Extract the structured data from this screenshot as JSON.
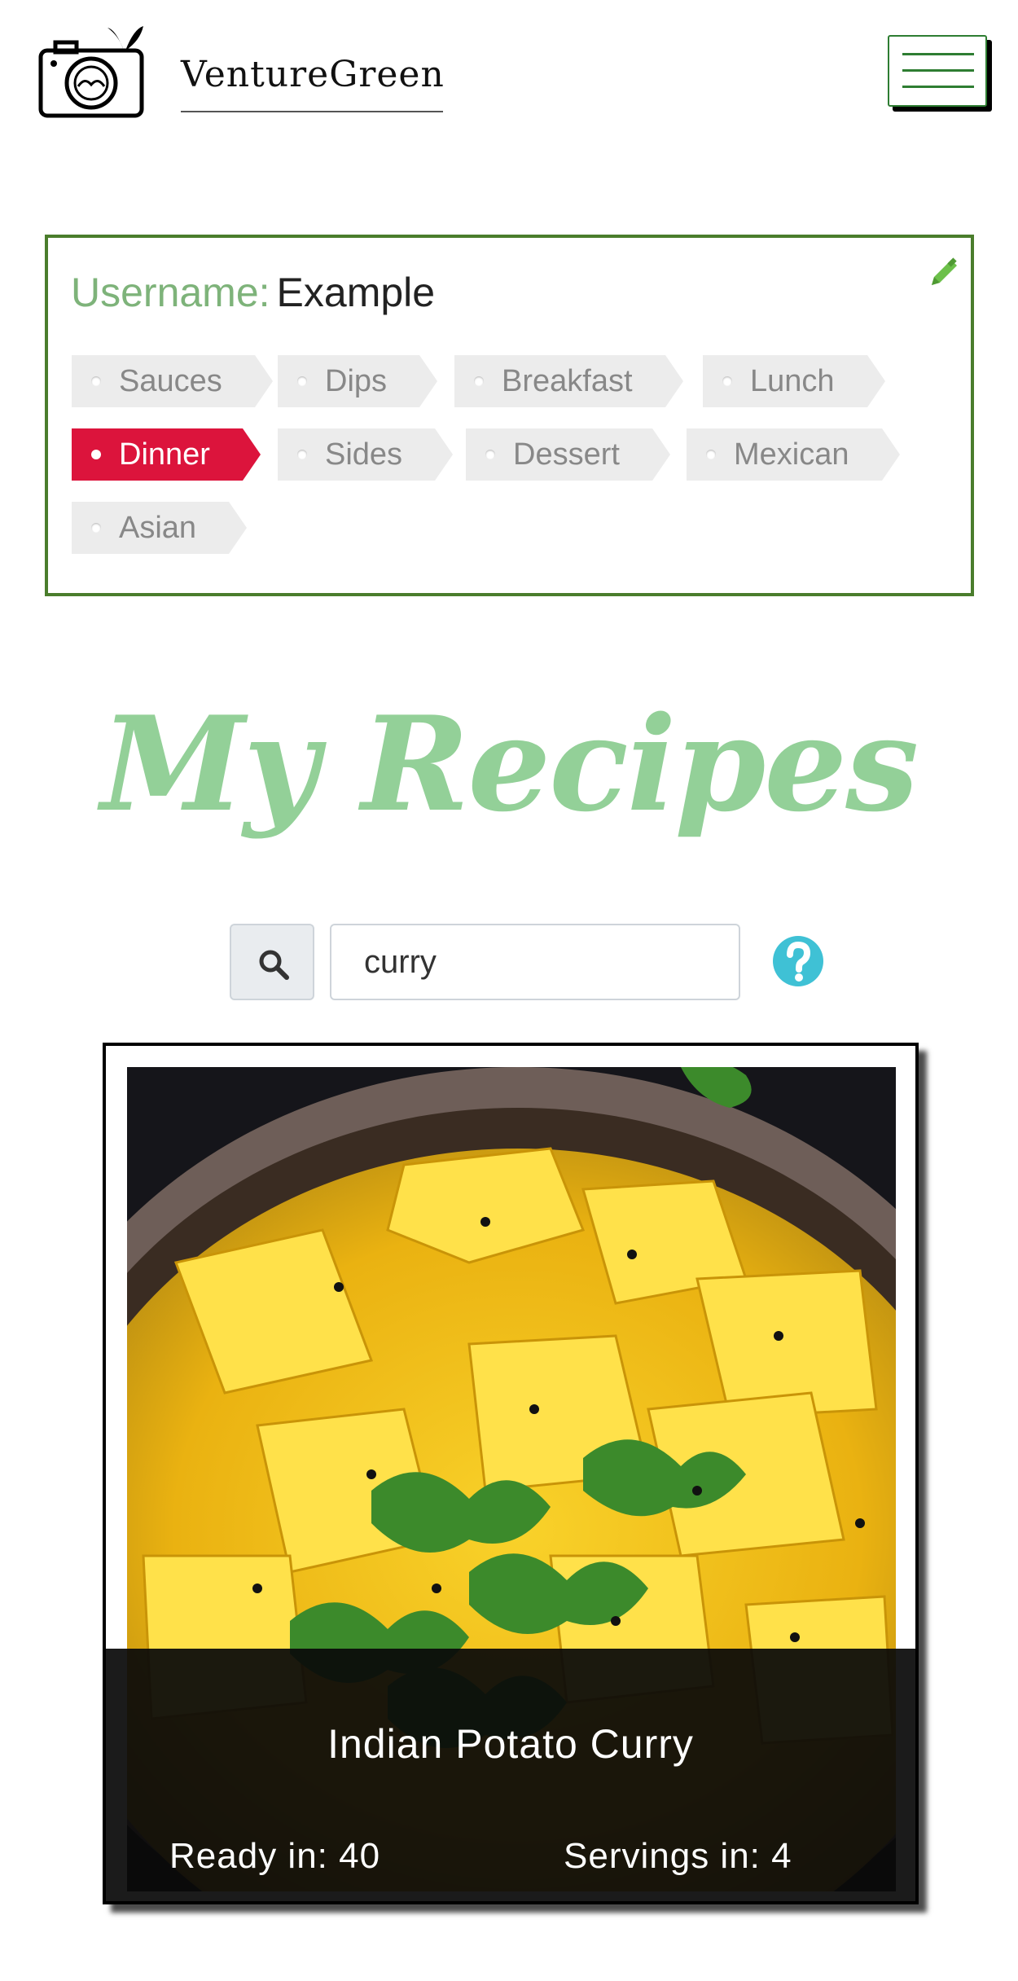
{
  "header": {
    "brand": "VentureGreen",
    "logo_icon": "camera-leaf-icon",
    "menu_icon": "hamburger-icon"
  },
  "profile": {
    "username_label": "Username:",
    "username_value": "Example",
    "edit_icon": "pencil-icon",
    "tags": [
      {
        "label": "Sauces",
        "active": false
      },
      {
        "label": "Dips",
        "active": false
      },
      {
        "label": "Breakfast",
        "active": false
      },
      {
        "label": "Lunch",
        "active": false
      },
      {
        "label": "Dinner",
        "active": true
      },
      {
        "label": "Sides",
        "active": false
      },
      {
        "label": "Dessert",
        "active": false
      },
      {
        "label": "Mexican",
        "active": false
      },
      {
        "label": "Asian",
        "active": false
      }
    ]
  },
  "main": {
    "title": "My Recipes",
    "search": {
      "value": "curry",
      "icon": "search-icon",
      "help_icon": "question-circle-icon"
    },
    "recipes": [
      {
        "name": "Indian Potato Curry",
        "ready": "Ready in: 40",
        "servings": "Servings in: 4"
      }
    ]
  },
  "colors": {
    "brand_green": "#4a7d2c",
    "title_green": "#93d098",
    "label_green": "#7eb37a",
    "active_tag": "#dc143c",
    "help_blue": "#3fc1d5"
  }
}
